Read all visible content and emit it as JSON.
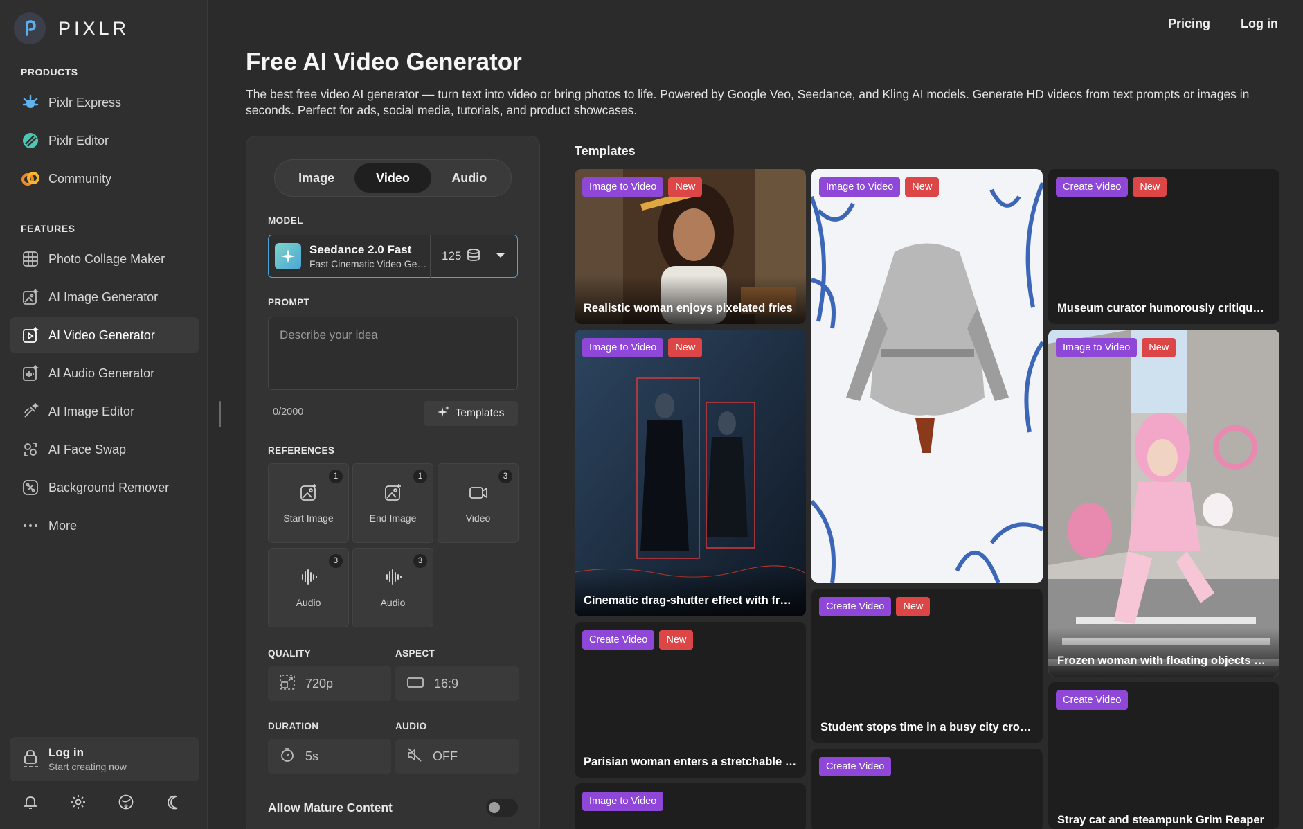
{
  "brand": {
    "name": "PIXLR"
  },
  "sidebar": {
    "products_heading": "PRODUCTS",
    "products": [
      {
        "label": "Pixlr Express",
        "icon": "pixlr-express-icon"
      },
      {
        "label": "Pixlr Editor",
        "icon": "pixlr-editor-icon"
      },
      {
        "label": "Community",
        "icon": "community-icon"
      }
    ],
    "features_heading": "FEATURES",
    "features": [
      {
        "label": "Photo Collage Maker",
        "icon": "collage-icon"
      },
      {
        "label": "AI Image Generator",
        "icon": "ai-image-icon"
      },
      {
        "label": "AI Video Generator",
        "icon": "ai-video-icon",
        "active": true
      },
      {
        "label": "AI Audio Generator",
        "icon": "ai-audio-icon"
      },
      {
        "label": "AI Image Editor",
        "icon": "ai-edit-icon"
      },
      {
        "label": "AI Face Swap",
        "icon": "face-swap-icon"
      },
      {
        "label": "Background Remover",
        "icon": "bg-remove-icon"
      },
      {
        "label": "More",
        "icon": "more-icon"
      }
    ],
    "login": {
      "title": "Log in",
      "subtitle": "Start creating now"
    }
  },
  "topnav": {
    "pricing": "Pricing",
    "login": "Log in"
  },
  "page": {
    "title": "Free AI Video Generator",
    "description": "The best free video AI generator — turn text into video or bring photos to life. Powered by Google Veo, Seedance, and Kling AI models. Generate HD videos from text prompts or images in seconds. Perfect for ads, social media, tutorials, and product showcases."
  },
  "panel": {
    "tabs": [
      "Image",
      "Video",
      "Audio"
    ],
    "active_tab": "Video",
    "model_label": "MODEL",
    "model": {
      "name": "Seedance 2.0 Fast",
      "subtitle": "Fast Cinematic Video Generation",
      "credits": "125"
    },
    "prompt_label": "PROMPT",
    "prompt_placeholder": "Describe your idea",
    "prompt_value": "",
    "counter": "0/2000",
    "templates_button": "Templates",
    "references_label": "REFERENCES",
    "references": [
      {
        "label": "Start Image",
        "count": "1",
        "icon": "image-icon"
      },
      {
        "label": "End Image",
        "count": "1",
        "icon": "image-icon"
      },
      {
        "label": "Video",
        "count": "3",
        "icon": "video-icon"
      },
      {
        "label": "Audio",
        "count": "3",
        "icon": "audio-wave-icon"
      },
      {
        "label": "Audio",
        "count": "3",
        "icon": "audio-wave-icon"
      }
    ],
    "quality_label": "QUALITY",
    "quality": "720p",
    "aspect_label": "ASPECT",
    "aspect": "16:9",
    "duration_label": "DURATION",
    "duration": "5s",
    "audio_label": "AUDIO",
    "audio": "OFF",
    "mature_label": "Allow Mature Content",
    "mature_enabled": false
  },
  "templates": {
    "heading": "Templates",
    "items": [
      {
        "type": "Image to Video",
        "new": "New",
        "caption": "Realistic woman enjoys pixelated fries"
      },
      {
        "type": "Image to Video",
        "new": "New",
        "caption": ""
      },
      {
        "type": "Create Video",
        "new": "New",
        "caption": "Museum curator humorously critiques art"
      },
      {
        "type": "Image to Video",
        "new": "New",
        "caption": "Cinematic drag-shutter effect with frames"
      },
      {
        "type": "Image to Video",
        "new": "New",
        "caption": "Frozen woman with floating objects around"
      },
      {
        "type": "Create Video",
        "new": "New",
        "caption": "Student stops time in a busy city crossing"
      },
      {
        "type": "Create Video",
        "new": "New",
        "caption": "Parisian woman enters a stretchable portal"
      },
      {
        "type": "Create Video",
        "new": "",
        "caption": "Stray cat and steampunk Grim Reaper"
      },
      {
        "type": "Create Video",
        "new": "",
        "caption": ""
      },
      {
        "type": "Image to Video",
        "new": "",
        "caption": ""
      }
    ]
  }
}
